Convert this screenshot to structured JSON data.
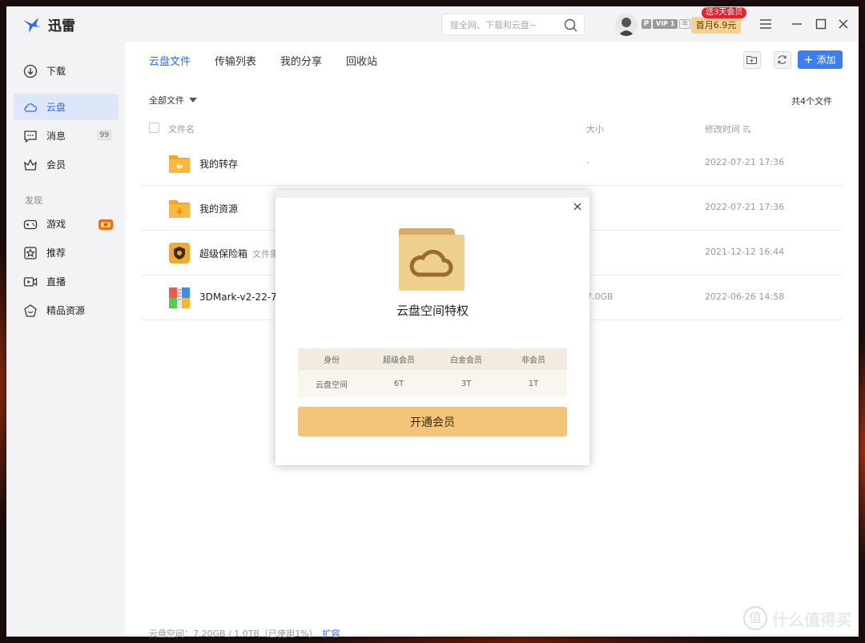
{
  "app": {
    "name": "迅雷"
  },
  "search": {
    "placeholder": "搜全网、下载和云盘~"
  },
  "user": {
    "vip_prefix": "P",
    "vip_level": "VIP 1",
    "vip_year": "年",
    "promo_tag": "送3天会员",
    "promo_price": "首月6.9元"
  },
  "sidebar": {
    "items": [
      {
        "label": "下载",
        "icon": "download-icon"
      },
      {
        "label": "云盘",
        "icon": "cloud-icon"
      },
      {
        "label": "消息",
        "icon": "message-icon",
        "badge": "99"
      },
      {
        "label": "会员",
        "icon": "crown-icon"
      }
    ],
    "section_label": "发现",
    "discover": [
      {
        "label": "游戏",
        "icon": "gamepad-icon"
      },
      {
        "label": "推荐",
        "icon": "star-icon"
      },
      {
        "label": "直播",
        "icon": "live-icon"
      },
      {
        "label": "精品资源",
        "icon": "gem-icon"
      }
    ]
  },
  "main": {
    "tabs": [
      "云盘文件",
      "传输列表",
      "我的分享",
      "回收站"
    ],
    "add_label": "添加",
    "filter_label": "全部文件",
    "file_count": "共4个文件",
    "columns": {
      "name": "文件名",
      "size": "大小",
      "modified": "修改时间"
    },
    "files": [
      {
        "name": "我的转存",
        "note": "",
        "size": "-",
        "date": "2022-07-21 17:36",
        "icon": "folder-transfer-icon"
      },
      {
        "name": "我的资源",
        "note": "",
        "size": "-",
        "date": "2022-07-21 17:36",
        "icon": "folder-download-icon"
      },
      {
        "name": "超级保险箱",
        "note": "文件需",
        "size": "-",
        "date": "2021-12-12 16:44",
        "icon": "safe-box-icon"
      },
      {
        "name": "3DMark-v2-22-7",
        "note": "",
        "size": "7.0GB",
        "date": "2022-06-26 14:58",
        "icon": "archive-icon"
      }
    ],
    "storage": {
      "text": "云盘空间：7.20GB / 1.0TB（已使用1%）",
      "link": "扩容"
    }
  },
  "modal": {
    "title": "云盘空间特权",
    "table_head": [
      "身份",
      "超级会员",
      "白金会员",
      "非会员"
    ],
    "table_row": [
      "云盘空间",
      "6T",
      "3T",
      "1T"
    ],
    "button": "开通会员"
  },
  "watermark": {
    "glyph": "值",
    "text": "什么值得买"
  },
  "colors": {
    "accent": "#2b6de4",
    "gold": "#f2c57b",
    "promo_red": "#e0242c"
  }
}
